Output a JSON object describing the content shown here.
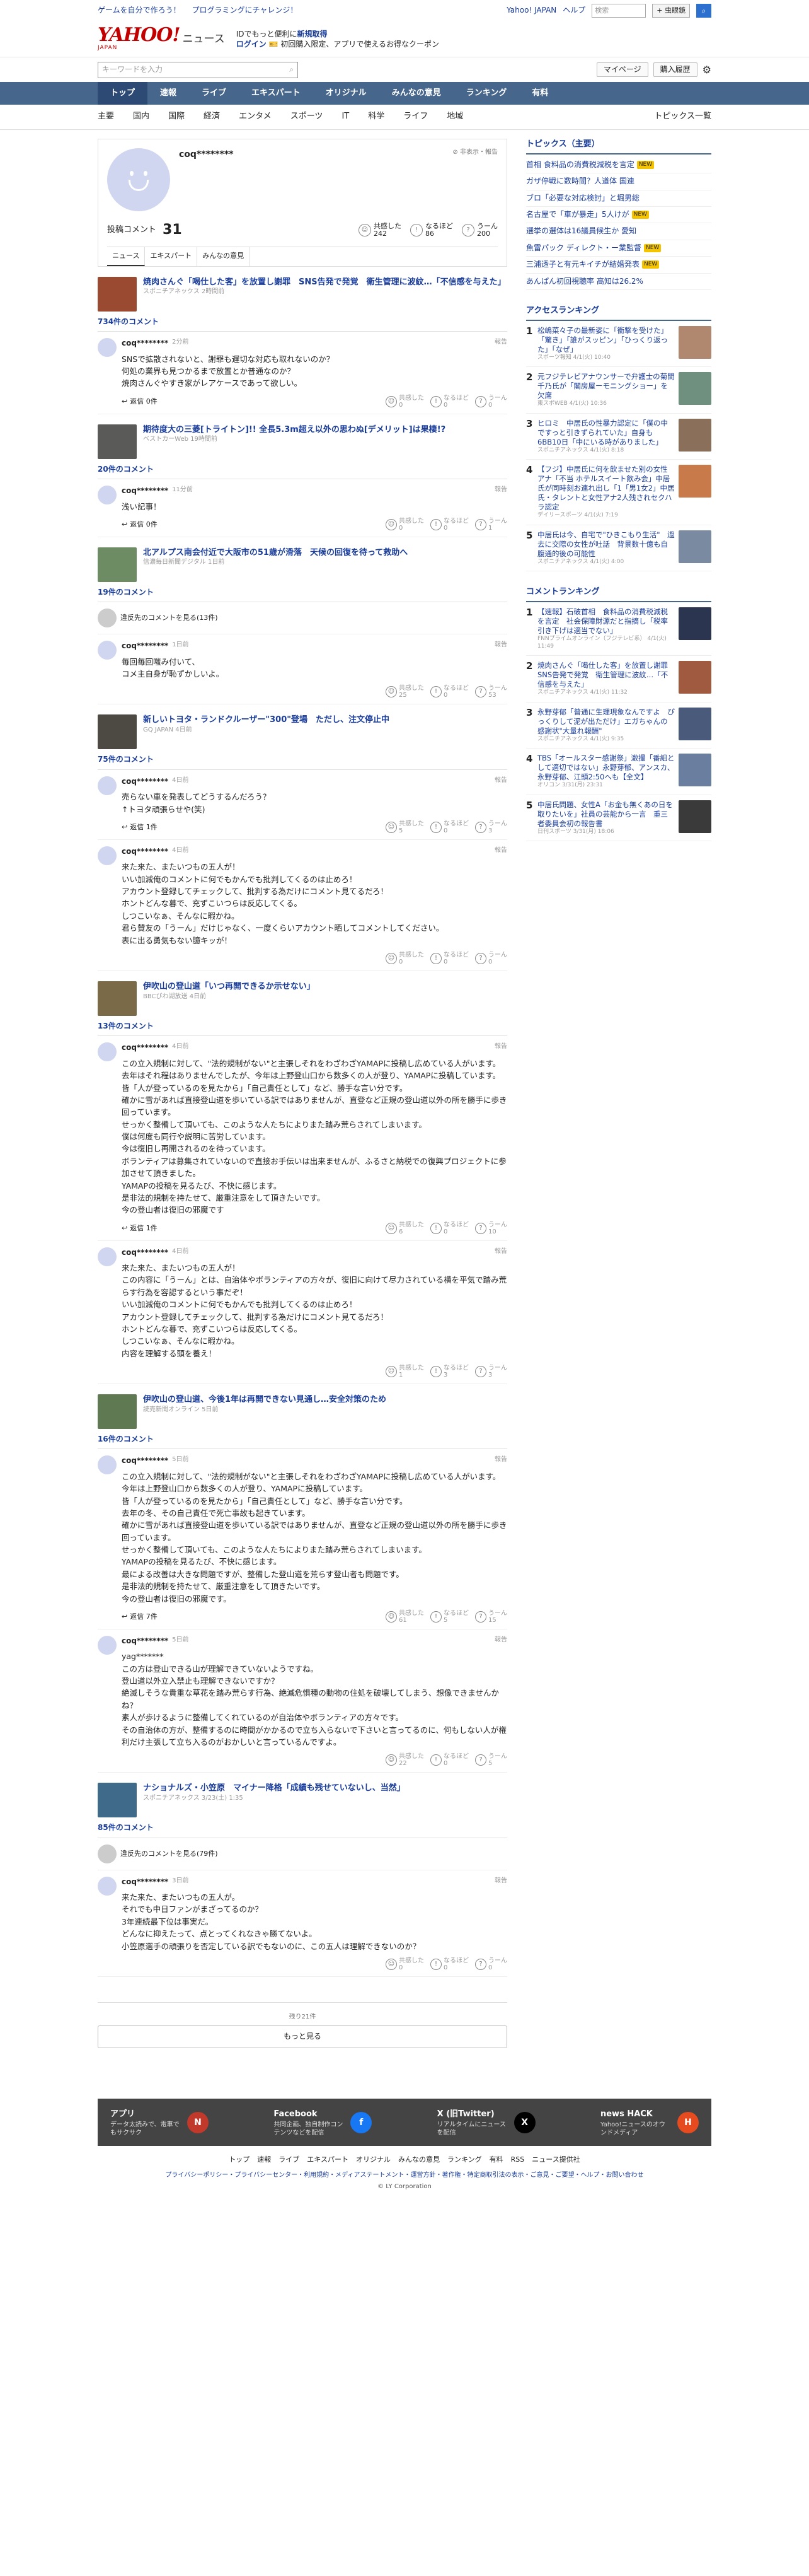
{
  "topbar": {
    "links": [
      "ゲームを自分で作ろう！",
      "プログラミングにチャレンジ！"
    ],
    "yahoo_japan": "Yahoo! JAPAN",
    "help": "ヘルプ",
    "search_placeholder": "検索",
    "search_btn": "+ 虫眼鏡"
  },
  "brand": {
    "logo": "YAHOO!",
    "logo_sub": "JAPAN",
    "section": "ニュース",
    "promo1": "IDでもっと便利に",
    "promo1b": "新規取得",
    "promo2": "ログイン",
    "promo3": "初回購入限定、アプリで使えるお得なクーポン"
  },
  "search": {
    "placeholder": "キーワードを入力",
    "mypage": "マイページ",
    "history": "購入履歴"
  },
  "nav": [
    "トップ",
    "速報",
    "ライブ",
    "エキスパート",
    "オリジナル",
    "みんなの意見",
    "ランキング",
    "有料"
  ],
  "subnav": [
    "主要",
    "国内",
    "国際",
    "経済",
    "エンタメ",
    "スポーツ",
    "IT",
    "科学",
    "ライフ",
    "地域"
  ],
  "subnav_right": "トピックス一覧",
  "profile": {
    "name": "coq********",
    "block": "非表示・報告",
    "count_label": "投稿コメント",
    "count": "31",
    "stats": [
      {
        "label": "共感した",
        "value": "242"
      },
      {
        "label": "なるほど",
        "value": "86"
      },
      {
        "label": "うーん",
        "value": "200"
      }
    ],
    "tabs": [
      "ニュース",
      "エキスパート",
      "みんなの意見"
    ]
  },
  "articles": [
    {
      "title": "焼肉さんぐ「喝仕した客」を放置し謝罪　SNS告発で発覚　衛生管理に波紋…「不信感を与えた」",
      "src": "スポニチアネックス 2時間前",
      "count": "734件のコメント",
      "comments": [
        {
          "name": "coq********",
          "time": "2分前",
          "text": "SNSで拡散されないと、謝罪も遅切な対応も取れないのか？\n何処の業界も見つかるまで放置とか普通なのか？\n焼肉さんぐやすき家がレアケースであって欲しい。",
          "reply": "返信 0件",
          "r": [
            "0",
            "0",
            "0"
          ]
        }
      ]
    },
    {
      "title": "期待度大の三菱[トライトン]!! 全長5.3m超え以外の思わぬ[デメリット]は果棲!?",
      "src": "ベストカーWeb 19時間前",
      "count": "20件のコメント",
      "comments": [
        {
          "name": "coq********",
          "time": "11分前",
          "text": "浅い記事！",
          "reply": "返信 0件",
          "r": [
            "0",
            "0",
            "1"
          ]
        }
      ]
    },
    {
      "title": "北アルプス南会付近で大阪市の51歳が滑落　天候の回復を待って救助へ",
      "src": "信濃毎日新聞デジタル 1日前",
      "count": "19件のコメント",
      "more": "違反先のコメントを見る(13件)",
      "comments": [
        {
          "name": "coq********",
          "time": "1日前",
          "text": "毎回毎回嗤み付いて、\nコメ主自身が恥ずかしいよ。",
          "reply": "",
          "r": [
            "25",
            "0",
            "53"
          ]
        }
      ]
    },
    {
      "title": "新しいトヨタ・ランドクルーザー\"300\"登場　ただし、注文停止中",
      "src": "GQ JAPAN 4日前",
      "count": "75件のコメント",
      "comments": [
        {
          "name": "coq********",
          "time": "4日前",
          "text": "売らない車を発表してどうするんだろう？\n↑トヨタ頑張らせや(笑)",
          "reply": "返信 1件",
          "r": [
            "5",
            "0",
            "3"
          ]
        },
        {
          "name": "coq********",
          "time": "4日前",
          "text": "来た来た、またいつもの五人が！\nいい加減俺のコメントに何でもかんでも批判してくるのは止めろ！\nアカウント登録してチェックして、批判する為だけにコメント見てるだろ！\nホントどんな暮で、充ずこいつらは反応してくる。\nしつこいなぁ、そんなに暇かね。\n君ら賛友の「うーん」だけじゃなく、一度くらいアカウント晒してコメントしてください。\n表に出る勇気もない臆キッが！",
          "reply": "",
          "r": [
            "0",
            "0",
            "0"
          ]
        }
      ]
    },
    {
      "title": "伊吹山の登山道「いつ再開できるか示せない」",
      "src": "BBCびわ湖放送 4日前",
      "count": "13件のコメント",
      "comments": [
        {
          "name": "coq********",
          "time": "4日前",
          "text": "この立入規制に対して、\"法的規制がない\"と主張しそれをわざわざYAMAPに投稿し広めている人がいます。\n去年はそれ程はありませんでしたが、今年は上野登山口から数多くの人が登り、YAMAPに投稿しています。\n皆「人が登っているのを見たから」「自己責任として」など、勝手な言い分です。\n確かに雪があれば直接登山道を歩いている訳ではありませんが、直登など正規の登山道以外の所を勝手に歩き回っています。\nせっかく整備して頂いても、このような人たちによりまた踏み荒らされてしまいます。\n僕は何度も同行や説明に苦労しています。\n今は復旧し再開されるのを待っています。\nボランティアは募集されていないので直接お手伝いは出来ませんが、ふるさと納税での復興プロジェクトに参加させて頂きました。\nYAMAPの投稿を見るたび、不快に感じます。\n是非法的規制を持たせて、厳重注意をして頂きたいです。\n今の登山者は復旧の邪魔です",
          "reply": "返信 1件",
          "r": [
            "6",
            "0",
            "10"
          ]
        },
        {
          "name": "coq********",
          "time": "4日前",
          "text": "来た来た、またいつもの五人が！\nこの内容に「うーん」とは、自治体やボランティアの方々が、復旧に向けて尽力されている横を平気で踏み荒らす行為を容認するという事だぞ！\nいい加減俺のコメントに何でもかんでも批判してくるのは止めろ！\nアカウント登録してチェックして、批判する為だけにコメント見てるだろ！\nホントどんな暮で、充ずこいつらは反応してくる。\nしつこいなぁ、そんなに暇かね。\n内容を理解する頭を養え！",
          "reply": "",
          "r": [
            "1",
            "3",
            "3"
          ]
        }
      ]
    },
    {
      "title": "伊吹山の登山道、今後1年は再開できない見通し…安全対策のため",
      "src": "読売新聞オンライン 5日前",
      "count": "16件のコメント",
      "comments": [
        {
          "name": "coq********",
          "time": "5日前",
          "text": "この立入規制に対して、\"法的規制がない\"と主張しそれをわざわざYAMAPに投稿し広めている人がいます。\n今年は上野登山口から数多くの人が登り、YAMAPに投稿しています。\n皆「人が登っているのを見たから」「自己責任として」など、勝手な言い分です。\n去年の冬、その自己責任で死亡事故も起きています。\n確かに雪があれば直接登山道を歩いている訳ではありませんが、直登など正規の登山道以外の所を勝手に歩き回っています。\nせっかく整備して頂いても、このような人たちによりまた踏み荒らされてしまいます。\nYAMAPの投稿を見るたび、不快に感じます。\n最による改善は大きな問題ですが、整備した登山道を荒らす登山者も問題です。\n是非法的規制を持たせて、厳重注意をして頂きたいです。\n今の登山者は復旧の邪魔です。",
          "reply": "返信 7件",
          "r": [
            "61",
            "5",
            "15"
          ]
        },
        {
          "name": "coq********",
          "time": "5日前",
          "text": "yag*******\nこの方は登山できる山が理解できていないようですね。\n登山道以外立入禁止も理解できないですか？\n絶滅しそうな貴重な草花を踏み荒らす行為、絶滅危惧種の動物の住処を破壊してしまう、想像できませんかね？\n素人が歩けるように整備してくれているのが自治体やボランティアの方々です。\nその自治体の方が、整備するのに時間がかかるので立ち入らないで下さいと言ってるのに、何もしない人が権利だけ主張して立ち入るのがおかしいと言っているんですよ。",
          "reply": "",
          "r": [
            "22",
            "0",
            "5"
          ]
        }
      ]
    },
    {
      "title": "ナショナルズ・小笠原　マイナー降格「成績も残せていないし、当然」",
      "src": "スポニチアネックス 3/23(土) 1:35",
      "count": "85件のコメント",
      "more": "違反先のコメントを見る(79件)",
      "comments": [
        {
          "name": "coq********",
          "time": "3日前",
          "text": "来た来た、またいつもの五人が。\nそれでも中日ファンがまざってるのか？\n3年連続最下位は事実だ。\nどんなに抑えたって、点とってくれなきゃ勝てないよ。\n小笠原選手の頑張りを否定している訳でもないのに、この五人は理解できないのか？",
          "reply": "",
          "r": [
            "0",
            "0",
            "0"
          ]
        }
      ]
    }
  ],
  "pager": {
    "remaining": "残り21件",
    "more": "もっと見る"
  },
  "topics": {
    "title": "トピックス（主要）",
    "items": [
      {
        "t": "首相 食料品の消費税減税を言定",
        "b": "NEW"
      },
      {
        "t": "ガザ停戦に数時間？人道体 国連",
        "b": ""
      },
      {
        "t": "ブロ「必要な対応検討」と堀男総",
        "b": ""
      },
      {
        "t": "名古屋で「車が暴走」5人けが",
        "b": "NEW"
      },
      {
        "t": "選挙の選体は16議員候生か 愛知",
        "b": ""
      },
      {
        "t": "魚雷パック ディレクト・ー業監督",
        "b": "NEW"
      },
      {
        "t": "三浦透子と有元キイチが結婚発表",
        "b": "NEW"
      },
      {
        "t": "あんぱん初回視聴率 高知は26.2%",
        "b": ""
      }
    ]
  },
  "access": {
    "title": "アクセスランキング",
    "items": [
      {
        "n": "1",
        "t": "松嶋菜々子の最新姿に「衝撃を受けた」「驚き」「誰がスッピン」「ひっくり返った」「なぜ」",
        "s": "スポーツ報知 4/1(火) 10:40"
      },
      {
        "n": "2",
        "t": "元フジテレビアナウンサーで弁護士の菊間千乃氏が「閣房屋ーモニングショー」を欠席",
        "s": "東スポWEB 4/1(火) 10:36"
      },
      {
        "n": "3",
        "t": "ヒロミ　中居氏の性暴力認定に「僕の中ですっと引きずられていた」自身も6BB10日「中にいる時がありました」",
        "s": "スポニチアネックス 4/1(火) 8:18"
      },
      {
        "n": "4",
        "t": "【フジ】中居氏に何を飲ませた別の女性アナ「不当 ホテルスイート飲み会」中居氏が同時刻お連れ出し「1「男1女2」中居氏・タレントと女性アナ2人残されセクハラ認定",
        "s": "デイリースポーツ 4/1(火) 7:19"
      },
      {
        "n": "5",
        "t": "中居氏は今、自宅で\"ひきこもり生活\"　過去に交際の女性が吐話　背景数十億も自腹通的後の可能性",
        "s": "スポニチアネックス 4/1(火) 4:00"
      }
    ]
  },
  "comment_rank": {
    "title": "コメントランキング",
    "items": [
      {
        "n": "1",
        "t": "【速報】石破首相　食料品の消費税減税を言定　社会保障財源だと指摘し「税率引き下げは適当でない」",
        "s": "FNNプライムオンライン（フジテレビ系） 4/1(火) 11:49"
      },
      {
        "n": "2",
        "t": "焼肉さんぐ「喝仕した客」を放置し謝罪　SNS告発で発覚　衛生管理に波紋…「不信感を与えた」",
        "s": "スポニチアネックス 4/1(火) 11:32"
      },
      {
        "n": "3",
        "t": "永野芽郁「普通に生理現象なんですよ　ぴっくりして泥が出ただけ」エガちゃんの感謝状\"大量れ報酬\"",
        "s": "スポニチアネックス 4/1(火) 9:35"
      },
      {
        "n": "4",
        "t": "TBS「オールスター感謝祭」激撮「番組として適切ではない」永野芽郁、アンスカ、永野芽郁、江頭2:50へも【全文】",
        "s": "オリコン 3/31(月) 23:31"
      },
      {
        "n": "5",
        "t": "中居氏問題、女性A「お金も無くあの日を取りたいを」社員の芸能から一言　重三者委員会初の報告書",
        "s": "日刊スポーツ 3/31(月) 18:06"
      }
    ]
  },
  "footer": {
    "items": [
      {
        "t": "アプリ",
        "d": "データ太読みで、電車でもサクサク",
        "icon": "N"
      },
      {
        "t": "Facebook",
        "d": "共同企画、独自制作コンテンツなどを配信",
        "icon": "f"
      },
      {
        "t": "X (旧Twitter)",
        "d": "リアルタイムにニュースを配信",
        "icon": "X"
      },
      {
        "t": "news HACK",
        "d": "Yahoo!ニュースのオウンドメディア",
        "icon": "H"
      }
    ],
    "nav": [
      "トップ",
      "速報",
      "ライブ",
      "エキスパート",
      "オリジナル",
      "みんなの意見",
      "ランキング",
      "有料",
      "RSS",
      "ニュース提供社"
    ],
    "legal": "プライバシーポリシー・プライバシーセンター・利用規約・メディアステートメント・運営方針・著作権・特定商取引法の表示・ご意見・ご要望・ヘルプ・お問い合わせ",
    "copy": "© LY Corporation"
  }
}
